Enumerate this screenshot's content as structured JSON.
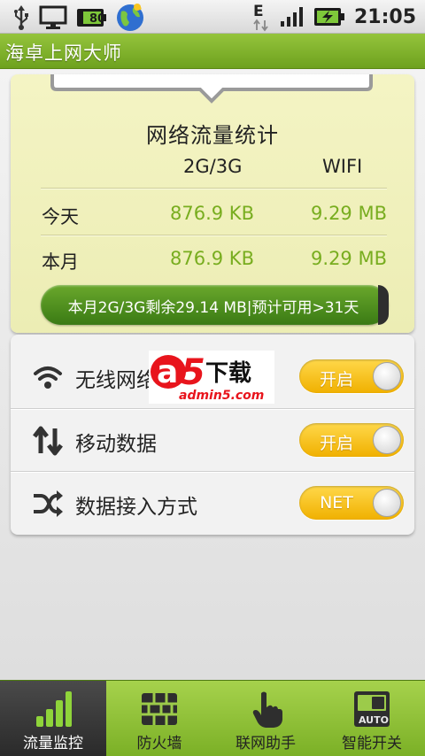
{
  "status_bar": {
    "network_type": "E",
    "time": "21:05",
    "battery_text": "80"
  },
  "app": {
    "title": "海卓上网大师"
  },
  "stats": {
    "title": "网络流量统计",
    "col_mobile": "2G/3G",
    "col_wifi": "WIFI",
    "rows": [
      {
        "label": "今天",
        "mobile": "876.9 KB",
        "wifi": "9.29 MB"
      },
      {
        "label": "本月",
        "mobile": "876.9 KB",
        "wifi": "9.29 MB"
      }
    ],
    "summary": "本月2G/3G剩余29.14 MB|预计可用>31天"
  },
  "settings": [
    {
      "label": "无线网络",
      "icon": "wifi-icon",
      "toggle": "开启"
    },
    {
      "label": "移动数据",
      "icon": "data-arrows-icon",
      "toggle": "开启"
    },
    {
      "label": "数据接入方式",
      "icon": "shuffle-icon",
      "toggle": "NET"
    }
  ],
  "watermark": {
    "brand_a": "a",
    "brand_num": "5",
    "brand_cn": "下载",
    "url": "admin5.com"
  },
  "nav": [
    {
      "label": "流量监控",
      "icon": "bar-chart-icon",
      "active": true
    },
    {
      "label": "防火墙",
      "icon": "firewall-icon",
      "active": false
    },
    {
      "label": "联网助手",
      "icon": "hand-pointer-icon",
      "active": false
    },
    {
      "label": "智能开关",
      "icon": "auto-switch-icon",
      "active": false
    }
  ],
  "colors": {
    "accent_green": "#78ad1f",
    "titlebar_green": "#7fb026",
    "toggle_yellow": "#f5c51a"
  }
}
